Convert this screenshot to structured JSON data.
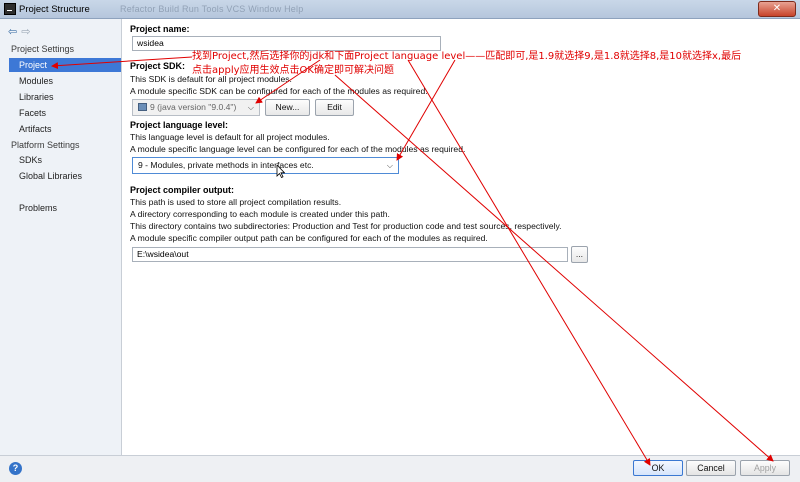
{
  "window": {
    "title": "Project Structure",
    "menu_ghost": "Refactor  Build  Run  Tools  VCS  Window  Help",
    "close_glyph": "✕"
  },
  "sidebar": {
    "nav_back": "⇦",
    "nav_forward": "⇨",
    "project_settings_header": "Project Settings",
    "platform_settings_header": "Platform Settings",
    "project_settings_items": [
      {
        "label": "Project",
        "selected": true
      },
      {
        "label": "Modules"
      },
      {
        "label": "Libraries"
      },
      {
        "label": "Facets"
      },
      {
        "label": "Artifacts"
      }
    ],
    "platform_settings_items": [
      {
        "label": "SDKs"
      },
      {
        "label": "Global Libraries"
      }
    ],
    "problems": "Problems"
  },
  "main": {
    "project_name_label": "Project name:",
    "project_name_value": "wsidea",
    "sdk_label": "Project SDK:",
    "sdk_desc1": "This SDK is default for all project modules.",
    "sdk_desc2": "A module specific SDK can be configured for each of the modules as required.",
    "sdk_selected": "9 (java version \"9.0.4\")",
    "sdk_new_button": "New...",
    "sdk_edit_button": "Edit",
    "lang_label": "Project language level:",
    "lang_desc1": "This language level is default for all project modules.",
    "lang_desc2": "A module specific language level can be configured for each of the modules as required.",
    "lang_selected": "9 - Modules, private methods in interfaces etc.",
    "output_label": "Project compiler output:",
    "output_desc1": "This path is used to store all project compilation results.",
    "output_desc2": "A directory corresponding to each module is created under this path.",
    "output_desc3": "This directory contains two subdirectories: Production and Test for production code and test sources, respectively.",
    "output_desc4": "A module specific compiler output path can be configured for each of the modules as required.",
    "output_path": "E:\\wsidea\\out",
    "browse_button": "..."
  },
  "footer": {
    "help": "?",
    "ok": "OK",
    "cancel": "Cancel",
    "apply": "Apply"
  },
  "annotation": {
    "line1": "找到Project,然后选择你的jdk和下面Project language level——匹配即可,是1.9就选择9,是1.8就选择8,是10就选择x,最后",
    "line2": "点击apply应用生效点击OK确定即可解决问题",
    "color": "#e00000"
  },
  "icons": {
    "chevron": "chevron-down-icon",
    "sdk": "jdk-folder-icon",
    "help": "help-icon"
  }
}
